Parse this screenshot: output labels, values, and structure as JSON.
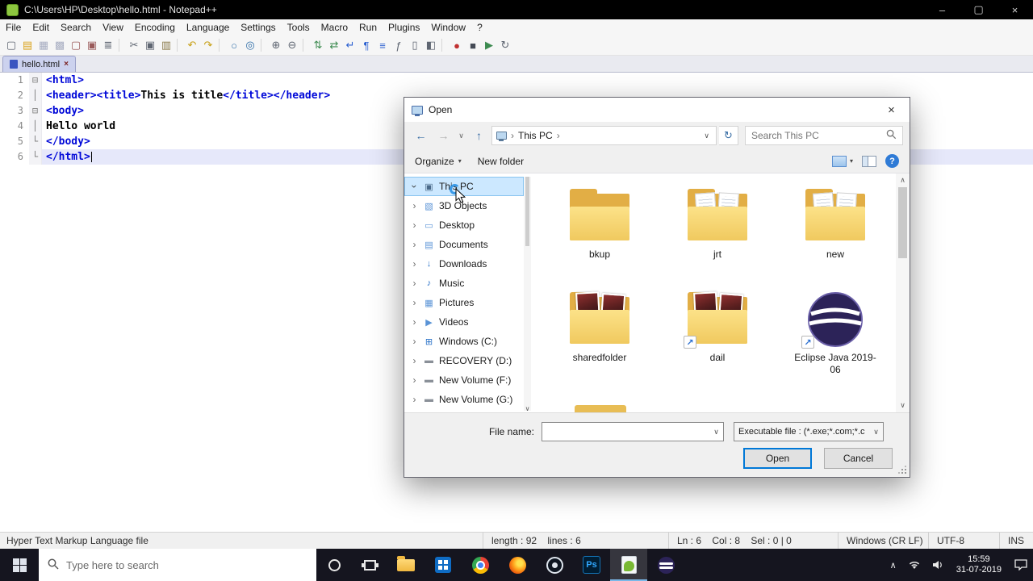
{
  "titlebar": {
    "title": "C:\\Users\\HP\\Desktop\\hello.html - Notepad++",
    "minimize": "–",
    "maximize": "▢",
    "close": "×"
  },
  "menubar": {
    "items": [
      "File",
      "Edit",
      "Search",
      "View",
      "Encoding",
      "Language",
      "Settings",
      "Tools",
      "Macro",
      "Run",
      "Plugins",
      "Window",
      "?"
    ]
  },
  "toolbar": {
    "icons": [
      {
        "name": "new-file-icon",
        "glyph": "▢",
        "color": "#5f6672"
      },
      {
        "name": "open-file-icon",
        "glyph": "▤",
        "color": "#d9a31c"
      },
      {
        "name": "save-icon",
        "glyph": "▦",
        "color": "#a8aec2"
      },
      {
        "name": "save-all-icon",
        "glyph": "▩",
        "color": "#a8aec2"
      },
      {
        "name": "close-file-icon",
        "glyph": "▢",
        "color": "#9a5a5a"
      },
      {
        "name": "close-all-icon",
        "glyph": "▣",
        "color": "#9a5a5a"
      },
      {
        "name": "print-icon",
        "glyph": "≣",
        "color": "#5f6672"
      },
      {
        "name": "separator",
        "glyph": "",
        "color": ""
      },
      {
        "name": "cut-icon",
        "glyph": "✂",
        "color": "#5f6672"
      },
      {
        "name": "copy-icon",
        "glyph": "▣",
        "color": "#5f6672"
      },
      {
        "name": "paste-icon",
        "glyph": "▥",
        "color": "#8a7a4a"
      },
      {
        "name": "separator",
        "glyph": "",
        "color": ""
      },
      {
        "name": "undo-icon",
        "glyph": "↶",
        "color": "#c8a118"
      },
      {
        "name": "redo-icon",
        "glyph": "↷",
        "color": "#c8a118"
      },
      {
        "name": "separator",
        "glyph": "",
        "color": ""
      },
      {
        "name": "find-icon",
        "glyph": "○",
        "color": "#2f6ea8"
      },
      {
        "name": "replace-icon",
        "glyph": "◎",
        "color": "#2f6ea8"
      },
      {
        "name": "separator",
        "glyph": "",
        "color": ""
      },
      {
        "name": "zoom-in-icon",
        "glyph": "⊕",
        "color": "#5f6672"
      },
      {
        "name": "zoom-out-icon",
        "glyph": "⊖",
        "color": "#5f6672"
      },
      {
        "name": "separator",
        "glyph": "",
        "color": ""
      },
      {
        "name": "sync-vertical-icon",
        "glyph": "⇅",
        "color": "#3d8b50"
      },
      {
        "name": "sync-horizontal-icon",
        "glyph": "⇄",
        "color": "#3d8b50"
      },
      {
        "name": "word-wrap-icon",
        "glyph": "↵",
        "color": "#2a5fd0"
      },
      {
        "name": "show-all-chars-icon",
        "glyph": "¶",
        "color": "#2a5fd0"
      },
      {
        "name": "indent-guide-icon",
        "glyph": "≡",
        "color": "#2a5fd0"
      },
      {
        "name": "function-list-icon",
        "glyph": "ƒ",
        "color": "#5f6672"
      },
      {
        "name": "doc-map-icon",
        "glyph": "▯",
        "color": "#5f6672"
      },
      {
        "name": "doc-switcher-icon",
        "glyph": "◧",
        "color": "#5f6672"
      },
      {
        "name": "separator",
        "glyph": "",
        "color": ""
      },
      {
        "name": "record-macro-icon",
        "glyph": "●",
        "color": "#c03030"
      },
      {
        "name": "stop-macro-icon",
        "glyph": "■",
        "color": "#444a55"
      },
      {
        "name": "play-macro-icon",
        "glyph": "▶",
        "color": "#3d8b50"
      },
      {
        "name": "run-macro-multiple-icon",
        "glyph": "↻",
        "color": "#5f6672"
      }
    ]
  },
  "tabbar": {
    "tabs": [
      {
        "label": "hello.html",
        "close_glyph": "×",
        "active": true
      }
    ]
  },
  "editor": {
    "lines": [
      {
        "num": "1",
        "fold": "⊟",
        "segments": [
          {
            "text": "<html>",
            "style": "tag"
          }
        ]
      },
      {
        "num": "2",
        "fold": "│",
        "segments": [
          {
            "text": "<header><title>",
            "style": "tag"
          },
          {
            "text": "This is title",
            "style": "text"
          },
          {
            "text": "</title></header>",
            "style": "tag"
          }
        ]
      },
      {
        "num": "3",
        "fold": "⊟",
        "segments": [
          {
            "text": "<body>",
            "style": "tag"
          }
        ]
      },
      {
        "num": "4",
        "fold": "│",
        "segments": [
          {
            "text": "Hello world",
            "style": "text"
          }
        ]
      },
      {
        "num": "5",
        "fold": "└",
        "segments": [
          {
            "text": "</body>",
            "style": "tag"
          }
        ]
      },
      {
        "num": "6",
        "fold": "└",
        "segments": [
          {
            "text": "</html>",
            "style": "tag"
          }
        ],
        "current": true
      }
    ]
  },
  "dialog": {
    "title": "Open",
    "close_glyph": "×",
    "nav": {
      "back_glyph": "←",
      "forward_glyph": "→",
      "dropdown_glyph": "∨",
      "up_glyph": "↑",
      "breadcrumb_chevron": "›",
      "breadcrumb_root": "This PC",
      "address_dropdown_glyph": "∨",
      "refresh_glyph": "↻",
      "search_placeholder": "Search This PC"
    },
    "commands": {
      "organize_label": "Organize",
      "new_folder_label": "New folder",
      "caret_glyph": "▾",
      "help_glyph": "?"
    },
    "tree": [
      {
        "label": "This PC",
        "icon": "computer-icon",
        "glyph": "▣",
        "color": "#4a6a8a",
        "expanded": true,
        "selected": true
      },
      {
        "label": "3D Objects",
        "icon": "3d-objects-icon",
        "glyph": "▧",
        "color": "#5a93d6"
      },
      {
        "label": "Desktop",
        "icon": "desktop-icon",
        "glyph": "▭",
        "color": "#5a93d6"
      },
      {
        "label": "Documents",
        "icon": "documents-icon",
        "glyph": "▤",
        "color": "#5a93d6"
      },
      {
        "label": "Downloads",
        "icon": "downloads-icon",
        "glyph": "↓",
        "color": "#2a72c8"
      },
      {
        "label": "Music",
        "icon": "music-icon",
        "glyph": "♪",
        "color": "#2a72c8"
      },
      {
        "label": "Pictures",
        "icon": "pictures-icon",
        "glyph": "▦",
        "color": "#5a93d6"
      },
      {
        "label": "Videos",
        "icon": "videos-icon",
        "glyph": "▶",
        "color": "#5a93d6"
      },
      {
        "label": "Windows (C:)",
        "icon": "windows-drive-icon",
        "glyph": "⊞",
        "color": "#2a72c8"
      },
      {
        "label": "RECOVERY (D:)",
        "icon": "drive-icon",
        "glyph": "▬",
        "color": "#8a9098"
      },
      {
        "label": "New Volume (F:)",
        "icon": "drive-icon",
        "glyph": "▬",
        "color": "#8a9098"
      },
      {
        "label": "New Volume (G:)",
        "icon": "drive-icon",
        "glyph": "▬",
        "color": "#8a9098"
      }
    ],
    "scrollbar": {
      "up_glyph": "∧",
      "down_glyph": "∨"
    },
    "files": [
      {
        "name": "bkup",
        "kind": "folder-empty"
      },
      {
        "name": "jrt",
        "kind": "folder-docs"
      },
      {
        "name": "new",
        "kind": "folder-docs"
      },
      {
        "name": "sharedfolder",
        "kind": "folder-media"
      },
      {
        "name": "dail",
        "kind": "folder-media",
        "shortcut": true
      },
      {
        "name": "Eclipse Java 2019-06",
        "kind": "eclipse",
        "shortcut": true
      }
    ],
    "footer": {
      "file_name_label": "File name:",
      "file_name_value": "",
      "combo_glyph": "∨",
      "file_type_value": "Executable file :  (*.exe;*.com;*.c",
      "open_label": "Open",
      "cancel_label": "Cancel"
    }
  },
  "statusbar": {
    "doctype": "Hyper Text Markup Language file",
    "length_info": "length : 92    lines : 6",
    "cursor_info": "Ln : 6    Col : 8    Sel : 0 | 0",
    "eol": "Windows (CR LF)",
    "encoding": "UTF-8",
    "insert_mode": "INS"
  },
  "taskbar": {
    "search_placeholder": "Type here to search",
    "tray_expand_glyph": "∧",
    "apps": [
      {
        "name": "file-explorer-icon"
      },
      {
        "name": "store-icon"
      },
      {
        "name": "chrome-icon"
      },
      {
        "name": "firefox-icon"
      },
      {
        "name": "media-player-icon"
      },
      {
        "name": "photoshop-icon",
        "label": "Ps"
      },
      {
        "name": "notepadpp-icon",
        "active": true
      },
      {
        "name": "eclipse-icon"
      }
    ],
    "clock_time": "15:59",
    "clock_date": "31-07-2019"
  }
}
